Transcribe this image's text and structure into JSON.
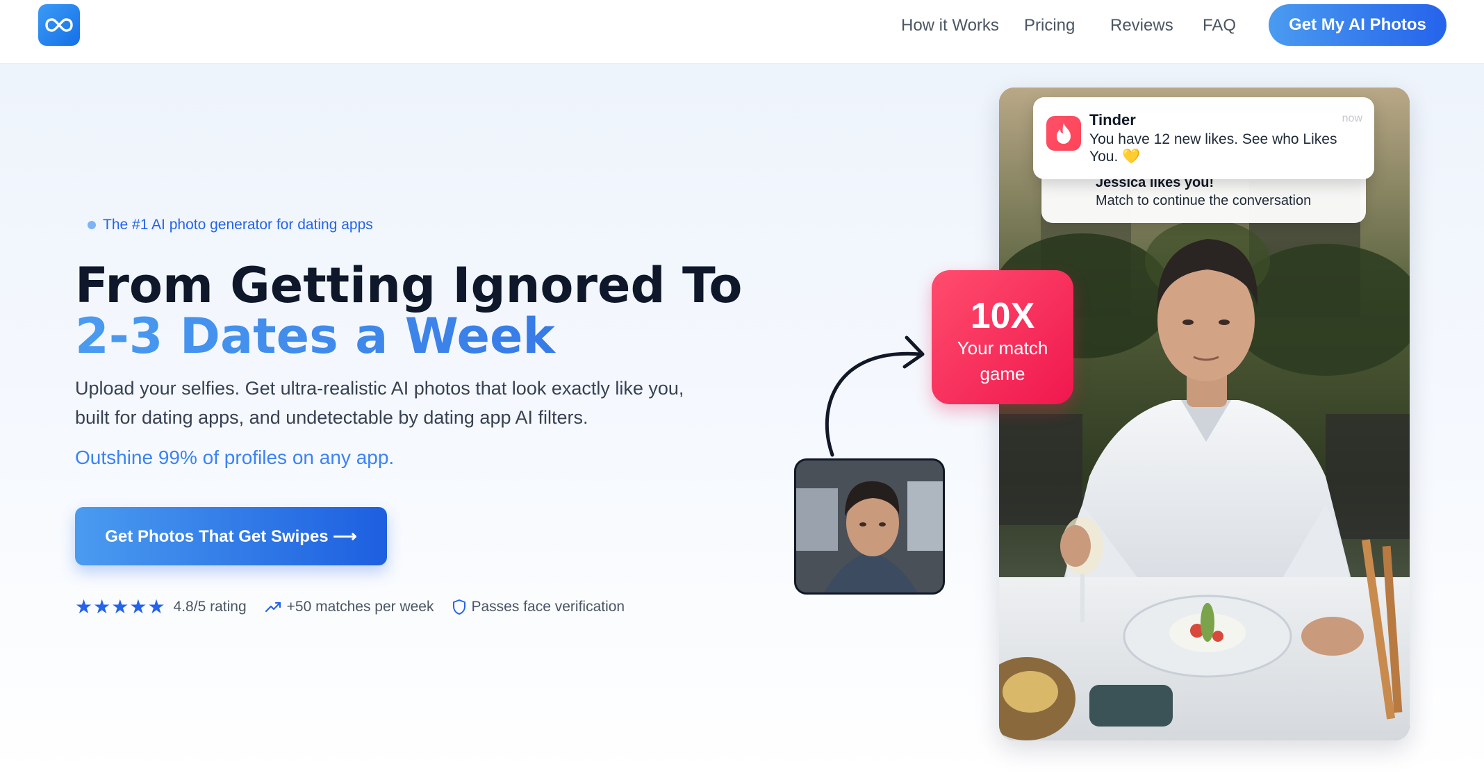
{
  "header": {
    "nav": [
      {
        "label": "How it Works"
      },
      {
        "label": "Pricing"
      },
      {
        "label": "Reviews"
      },
      {
        "label": "FAQ"
      }
    ],
    "cta_label": "Get My AI Photos",
    "logo_icon": "infinity-icon"
  },
  "hero": {
    "tagline": "The #1 AI photo generator for dating apps",
    "headline_line1": "From Getting Ignored To",
    "headline_line2": "2-3 Dates a Week",
    "subtext": "Upload your selfies. Get ultra-realistic AI photos that look exactly like you, built for dating apps, and undetectable by dating app AI filters.",
    "outshine": "Outshine 99% of profiles on any app.",
    "cta_label": "Get Photos That Get Swipes ⟶",
    "stats": {
      "rating": "4.8/5 rating",
      "stars": 5,
      "matches": "+50 matches per week",
      "verification": "Passes face verification"
    }
  },
  "visual": {
    "notification_front": {
      "app": "Tinder",
      "time": "now",
      "body": "You have 12 new likes. See who Likes You. 💛"
    },
    "notification_back": {
      "title": "Jessica likes you!",
      "body": "Match to continue the conversation"
    },
    "badge": {
      "big": "10X",
      "small": "Your match game"
    }
  },
  "colors": {
    "accent": "#2563eb",
    "accent_light": "#4a9bf0",
    "badge_pink": "#f0174e"
  }
}
